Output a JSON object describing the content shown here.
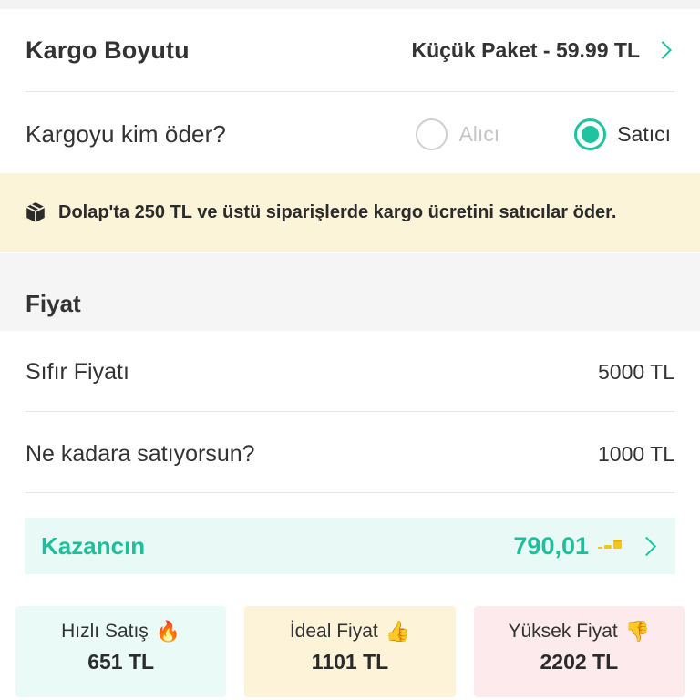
{
  "cargo": {
    "size_label": "Kargo Boyutu",
    "size_value": "Küçük Paket - 59.99 TL",
    "payer_label": "Kargoyu kim öder?",
    "payer_options": [
      {
        "label": "Alıcı",
        "selected": false
      },
      {
        "label": "Satıcı",
        "selected": true
      }
    ],
    "notice": "Dolap'ta 250 TL ve üstü siparişlerde kargo ücretini satıcılar öder."
  },
  "price": {
    "section_title": "Fiyat",
    "new_price_label": "Sıfır Fiyatı",
    "new_price_value": "5000 TL",
    "sale_price_label": "Ne kadara satıyorsun?",
    "sale_price_value": "1000 TL"
  },
  "earnings": {
    "label": "Kazancın",
    "value": "790,01"
  },
  "suggestions": [
    {
      "title": "Hızlı Satış",
      "emoji": "🔥",
      "icon": "fire-icon",
      "price": "651 TL"
    },
    {
      "title": "İdeal Fiyat",
      "emoji": "👍",
      "icon": "thumbs-up-icon",
      "price": "1101 TL"
    },
    {
      "title": "Yüksek Fiyat",
      "emoji": "👎",
      "icon": "thumbs-down-icon",
      "price": "2202 TL"
    }
  ],
  "colors": {
    "accent": "#1fc3a0",
    "notice_bg": "#fcf4d9",
    "fast_bg": "#e9faf7",
    "ideal_bg": "#fdf3d8",
    "high_bg": "#fdeaec"
  }
}
